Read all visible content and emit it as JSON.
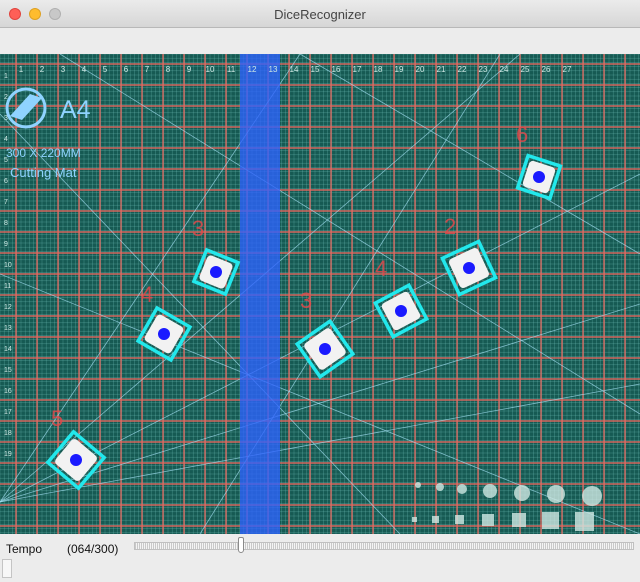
{
  "window": {
    "title": "DiceRecognizer"
  },
  "mat": {
    "brand": "A4",
    "size_text": "300 X 220MM",
    "product_text": "Cutting Mat",
    "top_ruler": [
      "1",
      "2",
      "3",
      "4",
      "5",
      "6",
      "7",
      "8",
      "9",
      "10",
      "11",
      "12",
      "13",
      "14",
      "15",
      "16",
      "17",
      "18",
      "19",
      "20",
      "21",
      "22",
      "23",
      "24",
      "25",
      "26",
      "27"
    ],
    "left_ruler": [
      "1",
      "2",
      "3",
      "4",
      "5",
      "6",
      "7",
      "8",
      "9",
      "10",
      "11",
      "12",
      "13",
      "14",
      "15",
      "16",
      "17",
      "18",
      "19"
    ]
  },
  "detections": [
    {
      "count": "6"
    },
    {
      "count": "2"
    },
    {
      "count": "3"
    },
    {
      "count": "4"
    },
    {
      "count": "3"
    },
    {
      "count": "4"
    },
    {
      "count": "5"
    }
  ],
  "trackbar": {
    "label": "Tempo",
    "value_text": "(064/300)",
    "value": 64,
    "max": 300
  },
  "colors": {
    "mat": "#165a53",
    "grid_major": "#e8675e",
    "grid_minor": "#7fcfc9",
    "box": "#22e8ec",
    "dot": "#1a1aff",
    "label": "#e0484a"
  }
}
